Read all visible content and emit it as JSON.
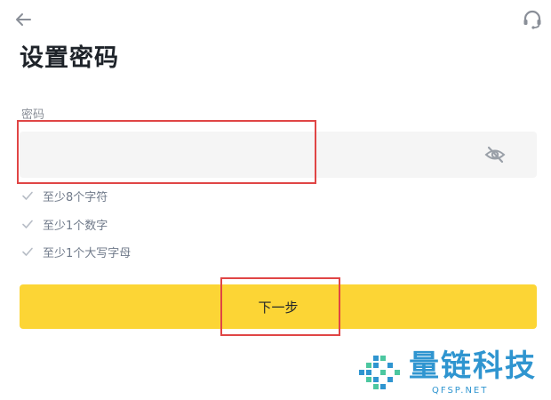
{
  "header": {
    "back_icon": "arrow-left-icon",
    "support_icon": "headset-icon"
  },
  "page_title": "设置密码",
  "password": {
    "label": "密码",
    "value": "",
    "placeholder": "",
    "visibility_icon": "eye-off-icon"
  },
  "rules": [
    {
      "text": "至少8个字符"
    },
    {
      "text": "至少1个数字"
    },
    {
      "text": "至少1个大写字母"
    }
  ],
  "next_button": {
    "label": "下一步"
  },
  "watermark": {
    "text": "量链科技",
    "sub": "QFSP.NET"
  },
  "colors": {
    "accent": "#fcd535",
    "highlight": "#e04545",
    "field_bg": "#f5f5f5",
    "check": "#b7bdc6",
    "watermark": "#2f95d0",
    "watermark_green": "#4cc7a0"
  }
}
